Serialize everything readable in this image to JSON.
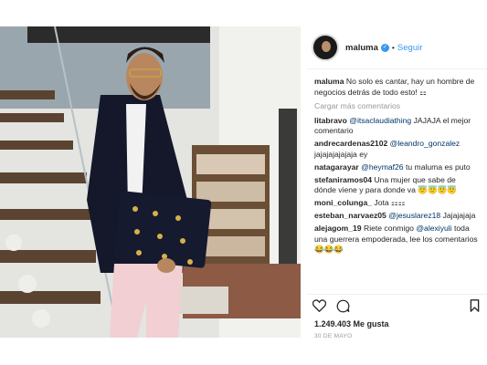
{
  "post": {
    "username": "maluma",
    "verified_icon": "verified-badge-icon",
    "follow_label": "Seguir",
    "separator": "•"
  },
  "caption": {
    "user": "maluma",
    "text": "No solo es cantar, hay un hombre de negocios detrás de todo esto! ⚏"
  },
  "load_more": "Cargar más comentarios",
  "comments": [
    {
      "user": "litabravo",
      "mention": "@itsaclaudiathing",
      "text": " JAJAJA el mejor comentario"
    },
    {
      "user": "andrecardenas2102",
      "mention": "@leandro_gonzalez",
      "text": " jajajajajajaja ey"
    },
    {
      "user": "natagarayar",
      "mention": "@heymaf26",
      "text": " tu maluma es puto"
    },
    {
      "user": "stefaniramos04",
      "mention": "",
      "text": "Una mujer que sabe de dónde viene y para donde va 😇😇😇😇"
    },
    {
      "user": "moni_colunga_",
      "mention": "",
      "text": "Jota ⚏⚏"
    },
    {
      "user": "esteban_narvaez05",
      "mention": "@jesuslarez18",
      "text": " Jajajajaja"
    },
    {
      "user": "alejagom_19",
      "mention": "",
      "text": "Riete conmigo ",
      "mention2": "@alexiyuli",
      "text2": " toda una guerrera empoderada, lee los comentarios 😂😂😂"
    }
  ],
  "actions": {
    "like_icon": "heart-icon",
    "comment_icon": "comment-icon",
    "save_icon": "bookmark-icon"
  },
  "likes": "1.249.403 Me gusta",
  "date": "30 DE MAYO"
}
